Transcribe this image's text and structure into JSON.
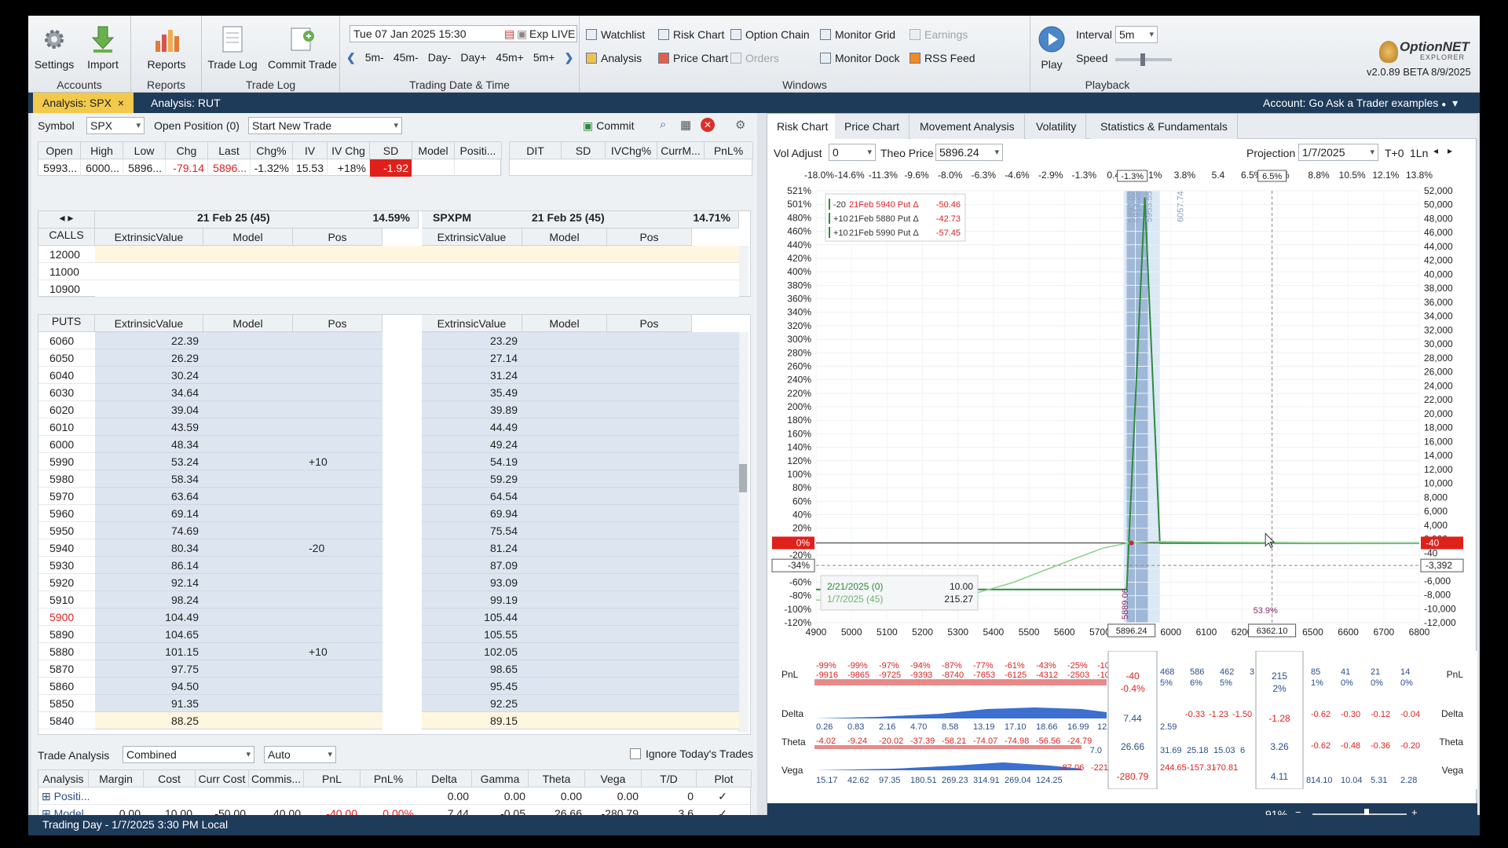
{
  "ribbon": {
    "accounts": {
      "label": "Accounts",
      "settings": "Settings",
      "import": "Import"
    },
    "reports": {
      "label": "Reports",
      "reports": "Reports"
    },
    "tradelog": {
      "label": "Trade Log",
      "trade_log": "Trade Log",
      "commit_trade": "Commit Trade"
    },
    "datetime": {
      "label": "Trading Date & Time",
      "value": "Tue 07 Jan 2025 15:30",
      "exp": "Exp LIVE",
      "steps": [
        "5m-",
        "45m-",
        "Day-",
        "Day+",
        "45m+",
        "5m+"
      ]
    },
    "windows": {
      "label": "Windows",
      "items": [
        {
          "label": "Watchlist",
          "enabled": true
        },
        {
          "label": "Risk Chart",
          "enabled": true
        },
        {
          "label": "Option Chain",
          "enabled": true
        },
        {
          "label": "Monitor Grid",
          "enabled": true
        },
        {
          "label": "Earnings",
          "enabled": false
        },
        {
          "label": "Analysis",
          "enabled": true
        },
        {
          "label": "Price Chart",
          "enabled": true
        },
        {
          "label": "Orders",
          "enabled": false
        },
        {
          "label": "Monitor Dock",
          "enabled": true
        },
        {
          "label": "RSS Feed",
          "enabled": true
        }
      ]
    },
    "playback": {
      "label": "Playback",
      "play": "Play",
      "interval_label": "Interval",
      "interval": "5m",
      "speed_label": "Speed"
    },
    "logo": {
      "name": "OptionNET",
      "sub": "EXPLORER",
      "version": "v2.0.89 BETA 8/9/2025"
    }
  },
  "tabs": [
    {
      "label": "Analysis: SPX",
      "active": true,
      "close": "×"
    },
    {
      "label": "Analysis: RUT",
      "active": false
    }
  ],
  "account": "Account: Go Ask a Trader examples",
  "left": {
    "symbol_label": "Symbol",
    "symbol": "SPX",
    "open_position": "Open Position (0)",
    "new_trade": "Start New Trade",
    "commit": "Commit",
    "quote_headers": [
      "Open",
      "High",
      "Low",
      "Chg",
      "Last",
      "Chg%",
      "IV",
      "IV Chg",
      "SD",
      "Model",
      "Positi..."
    ],
    "quote_values": [
      "5993...",
      "6000...",
      "5896...",
      "-79.14",
      "5896...",
      "-1.32%",
      "15.53",
      "+18%",
      "-1.92",
      "",
      ""
    ],
    "quote2_headers": [
      "DIT",
      "SD",
      "IVChg%",
      "CurrM...",
      "PnL%"
    ],
    "exp_left": {
      "date": "21 Feb 25 (45)",
      "iv": "14.59%"
    },
    "exp_right": {
      "name": "SPXPM",
      "date": "21 Feb 25 (45)",
      "iv": "14.71%"
    },
    "calls_label": "CALLS",
    "puts_label": "PUTS",
    "col_headers": [
      "ExtrinsicValue",
      "Model",
      "Pos"
    ],
    "calls": [
      "12000",
      "11000",
      "10900"
    ],
    "puts": [
      {
        "strike": "6060",
        "ev": "22.39",
        "pos": "",
        "ev2": "23.29"
      },
      {
        "strike": "6050",
        "ev": "26.29",
        "pos": "",
        "ev2": "27.14"
      },
      {
        "strike": "6040",
        "ev": "30.24",
        "pos": "",
        "ev2": "31.24"
      },
      {
        "strike": "6030",
        "ev": "34.64",
        "pos": "",
        "ev2": "35.49"
      },
      {
        "strike": "6020",
        "ev": "39.04",
        "pos": "",
        "ev2": "39.89"
      },
      {
        "strike": "6010",
        "ev": "43.59",
        "pos": "",
        "ev2": "44.49"
      },
      {
        "strike": "6000",
        "ev": "48.34",
        "pos": "",
        "ev2": "49.24"
      },
      {
        "strike": "5990",
        "ev": "53.24",
        "pos": "+10",
        "ev2": "54.19"
      },
      {
        "strike": "5980",
        "ev": "58.34",
        "pos": "",
        "ev2": "59.29"
      },
      {
        "strike": "5970",
        "ev": "63.64",
        "pos": "",
        "ev2": "64.54"
      },
      {
        "strike": "5960",
        "ev": "69.14",
        "pos": "",
        "ev2": "69.94"
      },
      {
        "strike": "5950",
        "ev": "74.69",
        "pos": "",
        "ev2": "75.54"
      },
      {
        "strike": "5940",
        "ev": "80.34",
        "pos": "-20",
        "ev2": "81.24"
      },
      {
        "strike": "5930",
        "ev": "86.14",
        "pos": "",
        "ev2": "87.09"
      },
      {
        "strike": "5920",
        "ev": "92.14",
        "pos": "",
        "ev2": "93.09"
      },
      {
        "strike": "5910",
        "ev": "98.24",
        "pos": "",
        "ev2": "99.19"
      },
      {
        "strike": "5900",
        "ev": "104.49",
        "pos": "",
        "ev2": "105.44"
      },
      {
        "strike": "5890",
        "ev": "104.65",
        "pos": "",
        "ev2": "105.55"
      },
      {
        "strike": "5880",
        "ev": "101.15",
        "pos": "+10",
        "ev2": "102.05"
      },
      {
        "strike": "5870",
        "ev": "97.75",
        "pos": "",
        "ev2": "98.65"
      },
      {
        "strike": "5860",
        "ev": "94.50",
        "pos": "",
        "ev2": "95.45"
      },
      {
        "strike": "5850",
        "ev": "91.35",
        "pos": "",
        "ev2": "92.25"
      },
      {
        "strike": "5840",
        "ev": "88.25",
        "pos": "",
        "ev2": "89.15"
      }
    ],
    "trade_analysis": {
      "label": "Trade Analysis",
      "mode": "Combined",
      "auto": "Auto",
      "ignore": "Ignore Today's Trades",
      "headers": [
        "Analysis",
        "Margin",
        "Cost",
        "Curr Cost",
        "Commis...",
        "PnL",
        "PnL%",
        "Delta",
        "Gamma",
        "Theta",
        "Vega",
        "T/D",
        "Plot"
      ],
      "rows": [
        [
          "Positi...",
          "",
          "",
          "",
          "",
          "",
          "",
          "0.00",
          "0.00",
          "0.00",
          "0.00",
          "0",
          "✓"
        ],
        [
          "Model",
          "0.00",
          "10.00",
          "-50.00",
          "40.00",
          "-40.00",
          "0.00%",
          "7.44",
          "-0.05",
          "26.66",
          "-280.79",
          "3.6",
          "✓"
        ]
      ]
    }
  },
  "right": {
    "tabs": [
      "Risk Chart",
      "Price Chart",
      "Movement Analysis",
      "Volatility",
      "Statistics & Fundamentals"
    ],
    "vol_adjust_label": "Vol Adjust",
    "vol_adjust": "0",
    "theo_label": "Theo Price",
    "theo": "5896.24",
    "projection_label": "Projection",
    "projection": "1/7/2025",
    "t0": "T+0",
    "period": "1Ln",
    "legend": [
      {
        "qty": "-20",
        "text": "21Feb 5940 Put Δ",
        "val": "-50.46"
      },
      {
        "qty": "+10",
        "text": "21Feb 5880 Put Δ",
        "val": "-42.73"
      },
      {
        "qty": "+10",
        "text": "21Feb 5990 Put Δ",
        "val": "-57.45"
      }
    ],
    "bottom_legend": [
      {
        "label": "2/21/2025 (0)",
        "val": "10.00"
      },
      {
        "label": "1/7/2025 (45)",
        "val": "215.27"
      }
    ],
    "zoom": "91%"
  },
  "chart_data": {
    "type": "line",
    "title": "",
    "xlabel": "",
    "ylabel": "",
    "x_ticks": [
      "4900",
      "5000",
      "5100",
      "5200",
      "5300",
      "5400",
      "5500",
      "5600",
      "5700",
      "580",
      "6000",
      "6100",
      "6200",
      "6",
      "6500",
      "6600",
      "6700",
      "6800"
    ],
    "top_pct_ticks": [
      "-18.0%",
      "-14.6%",
      "-11.3%",
      "-9.6%",
      "-8.0%",
      "-6.3%",
      "-4.6%",
      "-2.9%",
      "-1.3%",
      "0.4%",
      "2.1%",
      "3.8%",
      "5.4",
      "6.5%",
      "%",
      "8.8%",
      "10.5%",
      "12.1%",
      "13.8%"
    ],
    "y_left_ticks": [
      "521%",
      "501%",
      "480%",
      "460%",
      "440%",
      "420%",
      "400%",
      "380%",
      "360%",
      "340%",
      "320%",
      "300%",
      "280%",
      "260%",
      "240%",
      "220%",
      "200%",
      "180%",
      "160%",
      "140%",
      "120%",
      "100%",
      "80%",
      "60%",
      "40%",
      "20%",
      "0%",
      "-20%",
      "-34%",
      "-60%",
      "-80%",
      "-100%",
      "-120%"
    ],
    "y_right_ticks": [
      "52,000",
      "50,000",
      "48,000",
      "46,000",
      "44,000",
      "42,000",
      "40,000",
      "38,000",
      "36,000",
      "34,000",
      "32,000",
      "30,000",
      "28,000",
      "26,000",
      "24,000",
      "22,000",
      "20,000",
      "18,000",
      "16,000",
      "14,000",
      "12,000",
      "10,000",
      "8,000",
      "6,000",
      "4,000",
      "2,000",
      "-40",
      "-3,392",
      "-6,000",
      "-8,000",
      "-10,000",
      "-12,000"
    ],
    "xlim": [
      4850,
      6850
    ],
    "ylim": [
      -12000,
      53000
    ],
    "series": [
      {
        "name": "2/21/2025 (0)",
        "color": "#2e8b3c",
        "x": [
          4850,
          5870,
          5880,
          5940,
          5990,
          6850
        ],
        "y": [
          -7000,
          -7000,
          -7000,
          52000,
          -40,
          -40
        ]
      },
      {
        "name": "1/7/2025 (45)",
        "color": "#8fd08f",
        "x": [
          4850,
          5300,
          5500,
          5700,
          5800,
          5880,
          5990,
          6200,
          6500,
          6850
        ],
        "y": [
          -8600,
          -8600,
          -6000,
          -2500,
          -800,
          -40,
          200,
          100,
          30,
          10
        ]
      }
    ],
    "annotations": [
      "5893.02",
      "5914.28",
      "5953.55",
      "6057.74",
      "5889.06",
      "53.9%",
      "-1.3%",
      "6.5%"
    ],
    "price_marker": "5896.24",
    "price_marker2": "6362.10",
    "current_pnl": "0%",
    "current_pnl_right": "-40",
    "pnl_pct_line": "-34%",
    "pnl_line_right": "-3,392"
  },
  "greeks": {
    "row_labels": [
      "PnL",
      "Delta",
      "Theta",
      "Vega"
    ],
    "pnl_pct": [
      "-99%",
      "-99%",
      "-97%",
      "-94%",
      "-87%",
      "-77%",
      "-61%",
      "-43%",
      "-25%",
      "-10%"
    ],
    "pnl_vals": [
      "-9916",
      "-9865",
      "-9725",
      "-9393",
      "-8740",
      "-7653",
      "-6125",
      "-4312",
      "-2503",
      "-100"
    ],
    "delta": [
      "0.26",
      "0.83",
      "2.16",
      "4.70",
      "8.58",
      "13.19",
      "17.10",
      "18.66",
      "16.99",
      "12.6"
    ],
    "theta": [
      "-4.02",
      "-9.24",
      "-20.02",
      "-37.39",
      "-58.21",
      "-74.07",
      "-74.98",
      "-56.56",
      "-24.79"
    ],
    "vega": [
      "15.17",
      "42.62",
      "97.35",
      "180.51",
      "269.23",
      "314.91",
      "269.04",
      "124.25"
    ],
    "mid": {
      "pnl": "-40",
      "pnl_pct": "-0.4%",
      "delta": "7.44",
      "theta": "26.66",
      "vega": "-280.79",
      "theta_left": "7.0"
    },
    "after": {
      "pnl_pct": [
        "468",
        "586",
        "462",
        "3"
      ],
      "pnl_pct2": [
        "5%",
        "6%",
        "5%"
      ],
      "delta": "2.59",
      "delta_neg": [
        "-0.33",
        "-1.23",
        "-1.50"
      ],
      "theta": [
        "31.69",
        "25.18",
        "15.03",
        "6"
      ],
      "vega_neg": [
        "-87.06",
        "-221"
      ],
      "vega": [
        "244.65",
        "-157.31",
        "-70.81"
      ]
    },
    "right_mid": {
      "pnl": "215",
      "pnl_pct": "2%",
      "delta": "-1.28",
      "theta": "3.26",
      "vega": "4.11"
    },
    "far": {
      "pnl": [
        "85",
        "41",
        "21",
        "14"
      ],
      "pnl_pct": [
        "1%",
        "0%",
        "0%",
        "0%"
      ],
      "delta": [
        "-0.62",
        "-0.30",
        "-0.12",
        "-0.04"
      ],
      "theta": [
        "-0.62",
        "-0.48",
        "-0.36",
        "-0.20"
      ],
      "vega": [
        "14.10",
        "10.04",
        "5.31",
        "2.28"
      ],
      "vega_left": "8"
    }
  },
  "status": "Trading Day - 1/7/2025 3:30 PM Local",
  "colors": {
    "accent": "#f2c94c",
    "navy": "#1f3b5a",
    "red": "#e0201a",
    "green": "#2e8b3c",
    "light_green": "#8fd08f",
    "band": "#9fb8d8"
  }
}
